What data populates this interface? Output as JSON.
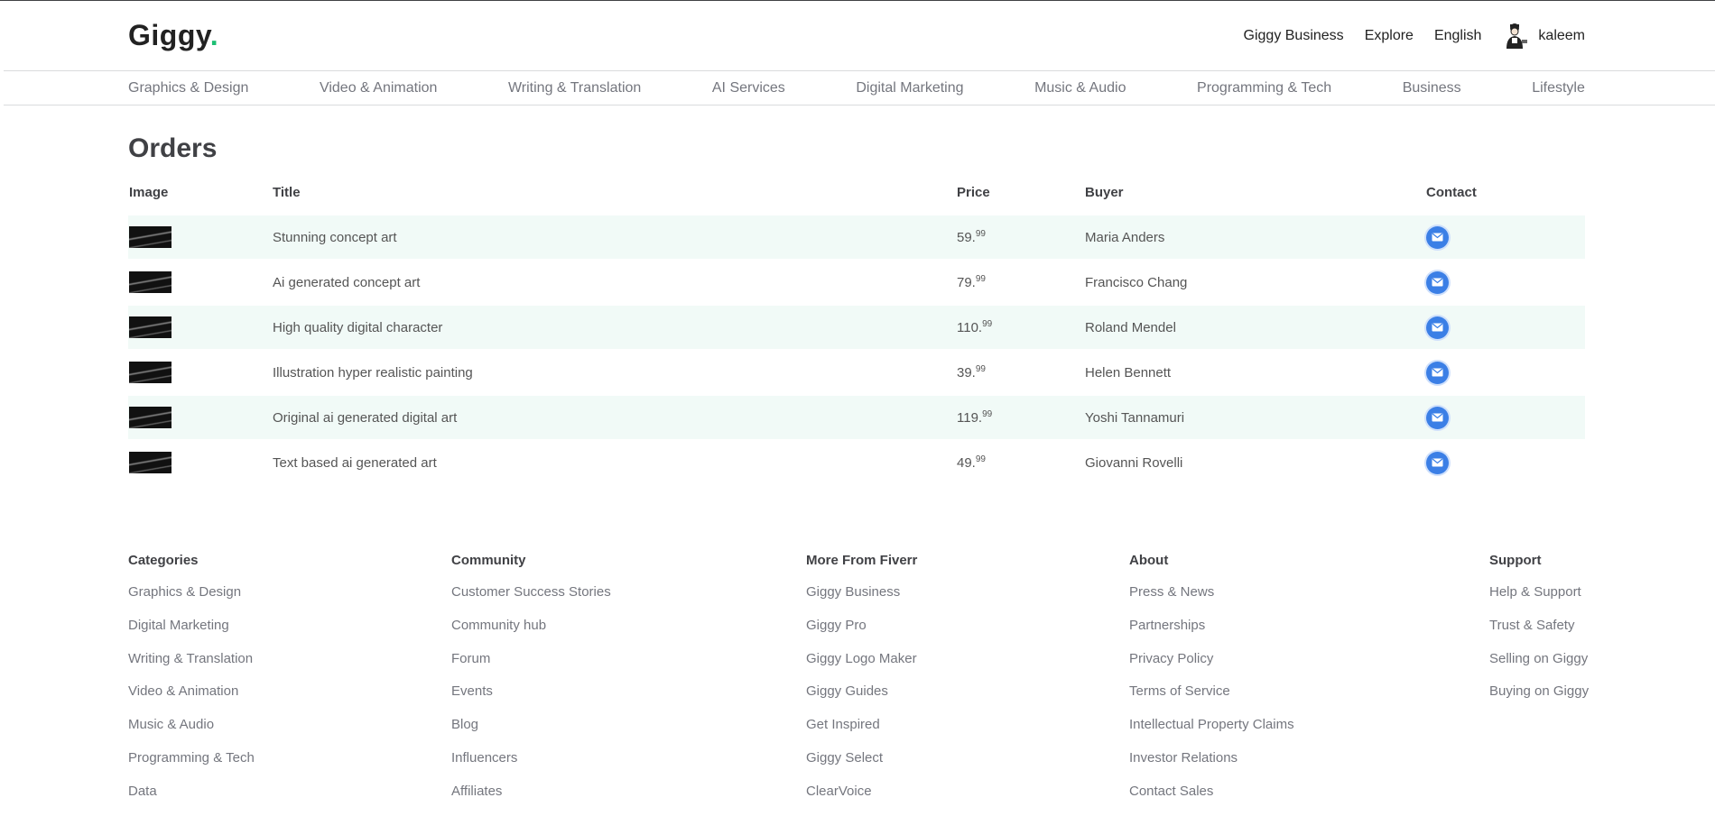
{
  "header": {
    "logo_text": "Giggy",
    "logo_dot": ".",
    "links": [
      "Giggy Business",
      "Explore",
      "English"
    ],
    "username": "kaleem"
  },
  "categories_nav": [
    "Graphics & Design",
    "Video & Animation",
    "Writing & Translation",
    "AI Services",
    "Digital Marketing",
    "Music & Audio",
    "Programming & Tech",
    "Business",
    "Lifestyle"
  ],
  "orders": {
    "title": "Orders",
    "columns": [
      "Image",
      "Title",
      "Price",
      "Buyer",
      "Contact"
    ],
    "rows": [
      {
        "title": "Stunning concept art",
        "price_main": "59.",
        "price_cents": "99",
        "buyer": "Maria Anders"
      },
      {
        "title": "Ai generated concept art",
        "price_main": "79.",
        "price_cents": "99",
        "buyer": "Francisco Chang"
      },
      {
        "title": "High quality digital character",
        "price_main": "110.",
        "price_cents": "99",
        "buyer": "Roland Mendel"
      },
      {
        "title": "Illustration hyper realistic painting",
        "price_main": "39.",
        "price_cents": "99",
        "buyer": "Helen Bennett"
      },
      {
        "title": "Original ai generated digital art",
        "price_main": "119.",
        "price_cents": "99",
        "buyer": "Yoshi Tannamuri"
      },
      {
        "title": "Text based ai generated art",
        "price_main": "49.",
        "price_cents": "99",
        "buyer": "Giovanni Rovelli"
      }
    ]
  },
  "footer": {
    "columns": [
      {
        "heading": "Categories",
        "links": [
          "Graphics & Design",
          "Digital Marketing",
          "Writing & Translation",
          "Video & Animation",
          "Music & Audio",
          "Programming & Tech",
          "Data"
        ]
      },
      {
        "heading": "Community",
        "links": [
          "Customer Success Stories",
          "Community hub",
          "Forum",
          "Events",
          "Blog",
          "Influencers",
          "Affiliates"
        ]
      },
      {
        "heading": "More From Fiverr",
        "links": [
          "Giggy Business",
          "Giggy Pro",
          "Giggy Logo Maker",
          "Giggy Guides",
          "Get Inspired",
          "Giggy Select",
          "ClearVoice"
        ]
      },
      {
        "heading": "About",
        "links": [
          "Press & News",
          "Partnerships",
          "Privacy Policy",
          "Terms of Service",
          "Intellectual Property Claims",
          "Investor Relations",
          "Contact Sales"
        ]
      },
      {
        "heading": "Support",
        "links": [
          "Help & Support",
          "Trust & Safety",
          "Selling on Giggy",
          "Buying on Giggy"
        ]
      }
    ]
  },
  "colors": {
    "accent": "#1dbf73",
    "row_shade": "#f1faf7",
    "mail_button": "#3b7fe6"
  },
  "icons": {
    "contact": "mail-icon",
    "profile": "avatar-icon"
  }
}
